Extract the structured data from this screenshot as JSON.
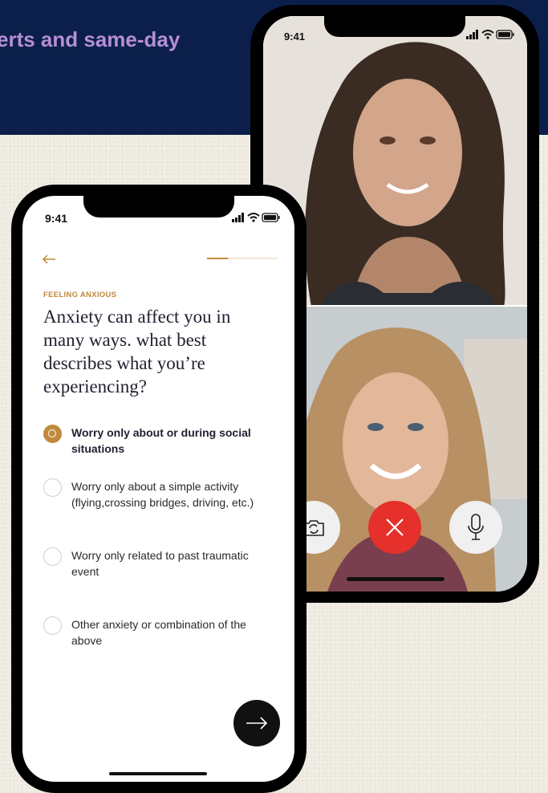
{
  "hero": {
    "text": "erts and same-day"
  },
  "video_phone": {
    "time": "9:41",
    "icons": [
      "signal-icon",
      "wifi-icon",
      "battery-icon",
      "camera-flip-icon",
      "end-call-icon",
      "microphone-icon"
    ],
    "colors": {
      "end_call": "#e5302b"
    }
  },
  "quiz_phone": {
    "time": "9:41",
    "progress": 0.3,
    "eyebrow": "FEELING ANXIOUS",
    "question": "Anxiety can affect you in many ways. what best describes what you’re experiencing?",
    "options": [
      {
        "label": "Worry only about or during social situations",
        "selected": true
      },
      {
        "label": "Worry only about a simple activity (flying,crossing bridges, driving, etc.)",
        "selected": false
      },
      {
        "label": "Worry only related to past traumatic event",
        "selected": false
      },
      {
        "label": "Other anxiety or combination of the above",
        "selected": false
      }
    ],
    "colors": {
      "accent": "#c08a3e",
      "hero_band": "#0c1f4a",
      "hero_text": "#b58fd6"
    }
  }
}
